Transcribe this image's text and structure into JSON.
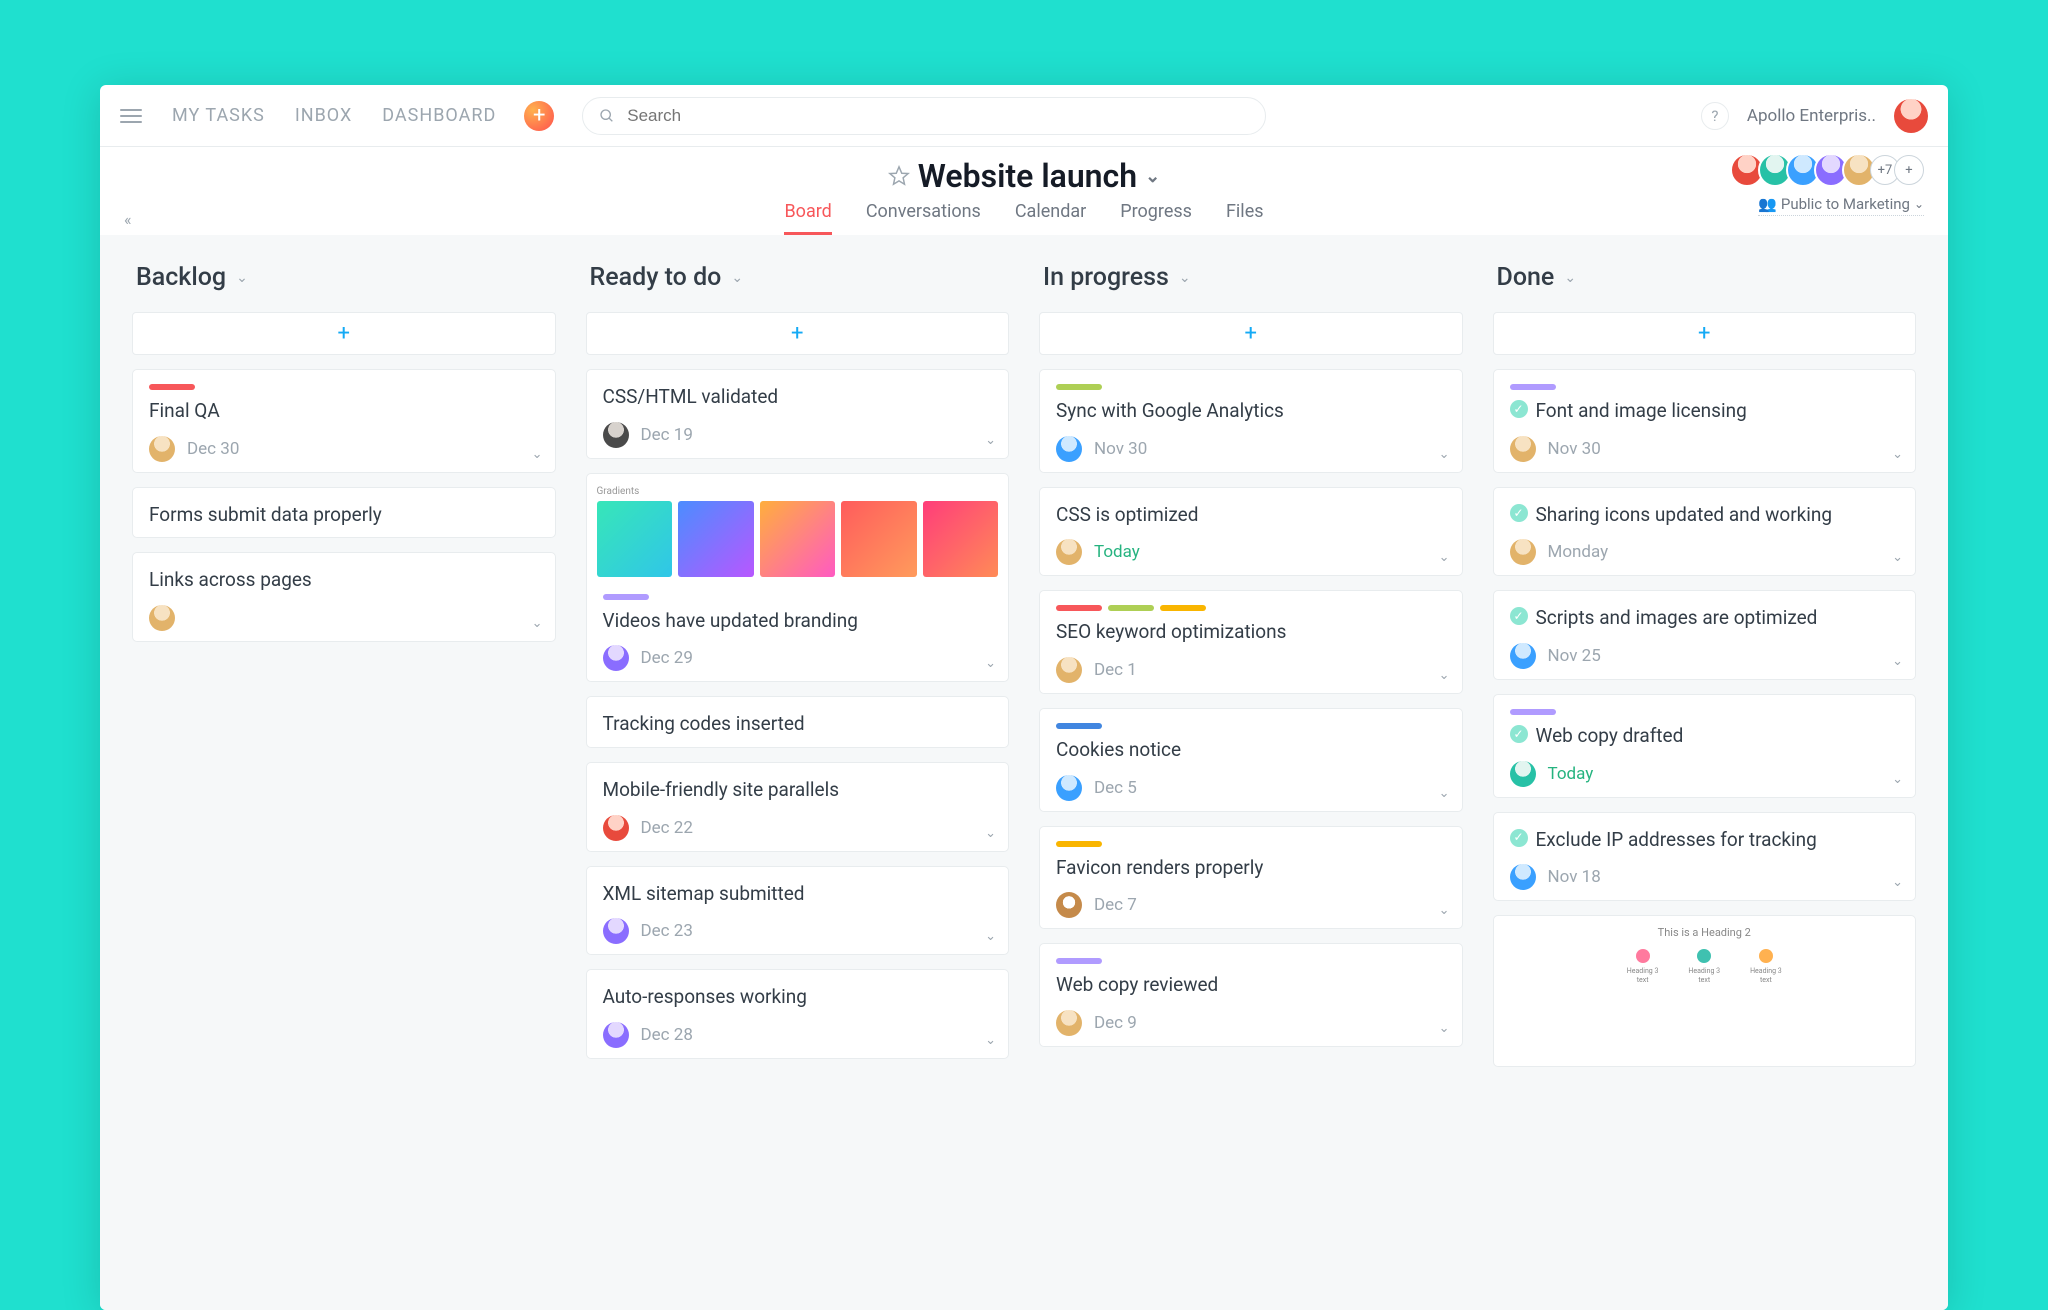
{
  "topnav": {
    "my_tasks": "MY TASKS",
    "inbox": "INBOX",
    "dashboard": "DASHBOARD",
    "search_placeholder": "Search",
    "help": "?",
    "workspace": "Apollo Enterpris.."
  },
  "project": {
    "title": "Website launch",
    "tabs": {
      "board": "Board",
      "conversations": "Conversations",
      "calendar": "Calendar",
      "progress": "Progress",
      "files": "Files"
    },
    "member_overflow": "+7",
    "visibility": "Public to Marketing"
  },
  "columns": [
    {
      "title": "Backlog",
      "cards": [
        {
          "tags": [
            "red"
          ],
          "title": "Final QA",
          "avatar": "blonde",
          "date": "Dec 30"
        },
        {
          "tags": [],
          "title": "Forms submit data properly"
        },
        {
          "tags": [],
          "title": "Links across pages",
          "avatar": "blonde"
        }
      ]
    },
    {
      "title": "Ready to do",
      "cards": [
        {
          "tags": [],
          "title": "CSS/HTML validated",
          "avatar": "dark",
          "date": "Dec 19"
        },
        {
          "cover": "gradients",
          "tags": [
            "purple"
          ],
          "title": "Videos have updated branding",
          "avatar": "purple",
          "date": "Dec 29"
        },
        {
          "tags": [],
          "title": "Tracking codes inserted"
        },
        {
          "tags": [],
          "title": "Mobile-friendly site parallels",
          "avatar": "red",
          "date": "Dec 22"
        },
        {
          "tags": [],
          "title": "XML sitemap submitted",
          "avatar": "purple",
          "date": "Dec 23"
        },
        {
          "tags": [],
          "title": "Auto-responses working",
          "avatar": "purple",
          "date": "Dec 28"
        }
      ]
    },
    {
      "title": "In progress",
      "cards": [
        {
          "tags": [
            "green"
          ],
          "title": "Sync with Google Analytics",
          "avatar": "cyan",
          "date": "Nov 30"
        },
        {
          "tags": [],
          "title": "CSS is optimized",
          "avatar": "blonde",
          "date": "Today",
          "today": true
        },
        {
          "tags": [
            "red",
            "green",
            "yellow"
          ],
          "title": "SEO keyword optimizations",
          "avatar": "blonde",
          "date": "Dec 1"
        },
        {
          "tags": [
            "blue"
          ],
          "title": "Cookies notice",
          "avatar": "cyan",
          "date": "Dec 5"
        },
        {
          "tags": [
            "yellow"
          ],
          "title": "Favicon renders properly",
          "avatar": "dog",
          "date": "Dec 7"
        },
        {
          "tags": [
            "purple"
          ],
          "title": "Web copy reviewed",
          "avatar": "blonde",
          "date": "Dec 9"
        }
      ]
    },
    {
      "title": "Done",
      "cards": [
        {
          "tags": [
            "purple"
          ],
          "done": true,
          "title": "Font and image licensing",
          "avatar": "blonde",
          "date": "Nov 30"
        },
        {
          "done": true,
          "title": "Sharing icons updated and working",
          "avatar": "blonde",
          "date": "Monday"
        },
        {
          "done": true,
          "title": "Scripts and images are optimized",
          "avatar": "cyan",
          "date": "Nov 25"
        },
        {
          "tags": [
            "purple"
          ],
          "done": true,
          "title": "Web copy drafted",
          "avatar": "teal",
          "date": "Today",
          "today": true
        },
        {
          "done": true,
          "title": "Exclude IP addresses for tracking",
          "avatar": "cyan",
          "date": "Nov 18"
        },
        {
          "cover": "heading"
        }
      ]
    }
  ],
  "covers": {
    "gradients_label": "Gradients",
    "heading_title": "This is a Heading 2"
  }
}
